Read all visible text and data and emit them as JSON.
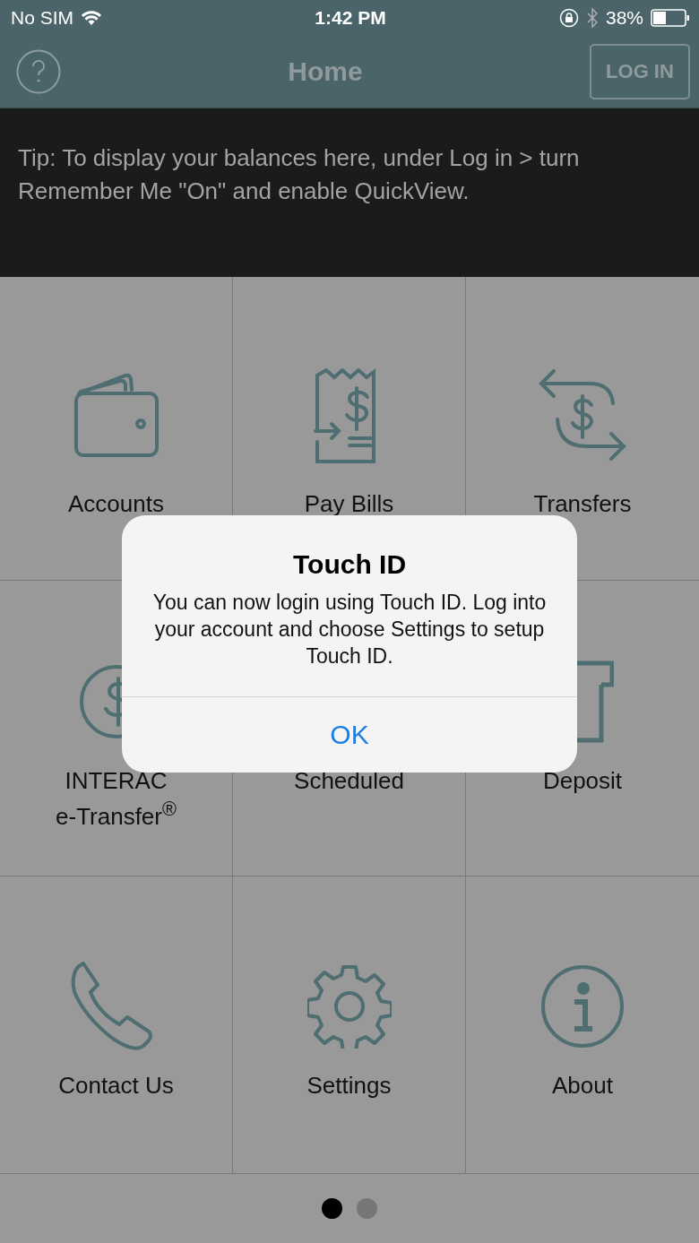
{
  "status_bar": {
    "carrier": "No SIM",
    "time": "1:42 PM",
    "battery": "38%"
  },
  "nav": {
    "title": "Home",
    "login_button": "LOG IN"
  },
  "tip": {
    "text": "Tip: To display your balances here, under Log in > turn Remember Me \"On\" and enable QuickView."
  },
  "tiles": [
    {
      "label": "Accounts"
    },
    {
      "label": "Pay Bills"
    },
    {
      "label": "Transfers"
    },
    {
      "label": "INTERAC\ne-Transfer$^{®}$"
    },
    {
      "label": "Scheduled"
    },
    {
      "label": "Deposit"
    },
    {
      "label": "Contact Us"
    },
    {
      "label": "Settings"
    },
    {
      "label": "About"
    }
  ],
  "alert": {
    "title": "Touch ID",
    "message": "You can now login using Touch ID. Log into your account and choose Settings to setup Touch ID.",
    "button": "OK"
  },
  "pager": {
    "dots": [
      {
        "selected": true
      },
      {
        "selected": false
      }
    ]
  }
}
